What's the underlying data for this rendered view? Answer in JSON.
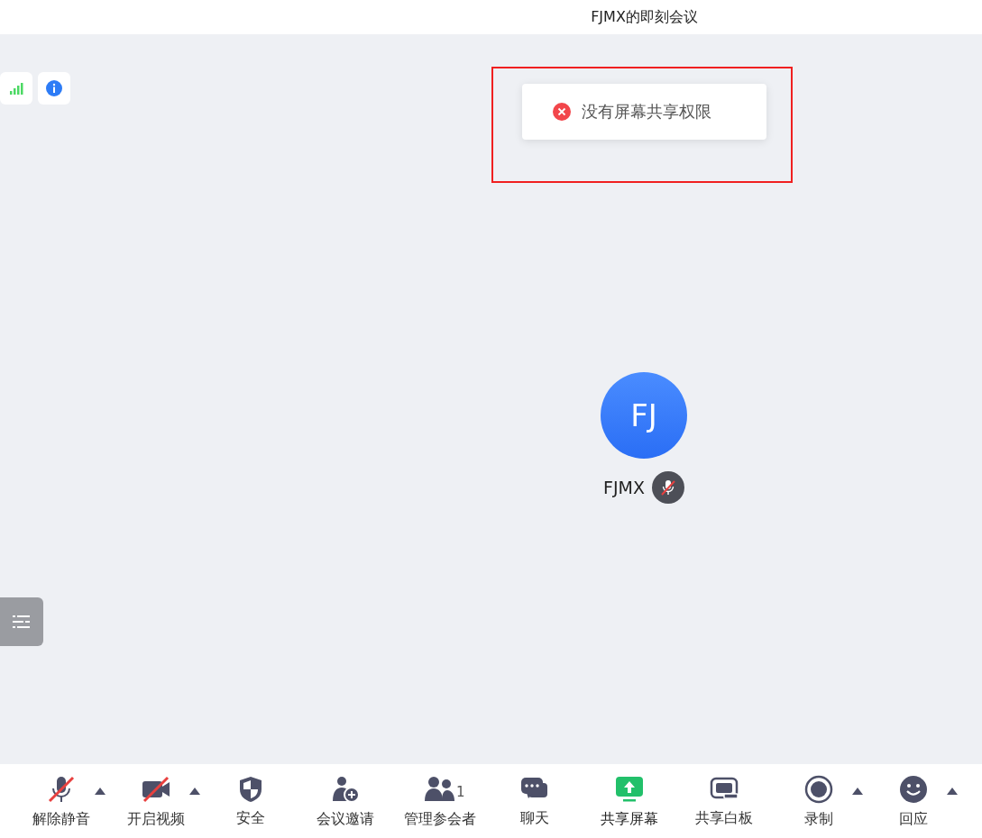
{
  "window": {
    "title": "FJMX的即刻会议"
  },
  "toast": {
    "kind": "error",
    "message": "没有屏幕共享权限"
  },
  "participant": {
    "initials": "FJ",
    "name": "FJMX",
    "muted": true
  },
  "toolbar": [
    {
      "kind": "mic",
      "label": "解除静音",
      "slashed": true,
      "highlighted": false,
      "menu": true
    },
    {
      "kind": "video",
      "label": "开启视频",
      "slashed": true,
      "highlighted": false,
      "menu": true
    },
    {
      "kind": "shield",
      "label": "安全",
      "slashed": false,
      "highlighted": false,
      "menu": false
    },
    {
      "kind": "invite",
      "label": "会议邀请",
      "slashed": false,
      "highlighted": false,
      "menu": false
    },
    {
      "kind": "people",
      "label": "管理参会者",
      "count": "1",
      "slashed": false,
      "highlighted": false,
      "menu": false
    },
    {
      "kind": "chat",
      "label": "聊天",
      "slashed": false,
      "highlighted": false,
      "menu": false
    },
    {
      "kind": "share",
      "label": "共享屏幕",
      "slashed": false,
      "highlighted": true,
      "menu": false
    },
    {
      "kind": "whiteboard",
      "label": "共享白板",
      "slashed": false,
      "highlighted": false,
      "menu": false
    },
    {
      "kind": "record",
      "label": "录制",
      "slashed": false,
      "highlighted": false,
      "menu": true
    },
    {
      "kind": "smile",
      "label": "回应",
      "slashed": false,
      "highlighted": false,
      "menu": true
    }
  ]
}
